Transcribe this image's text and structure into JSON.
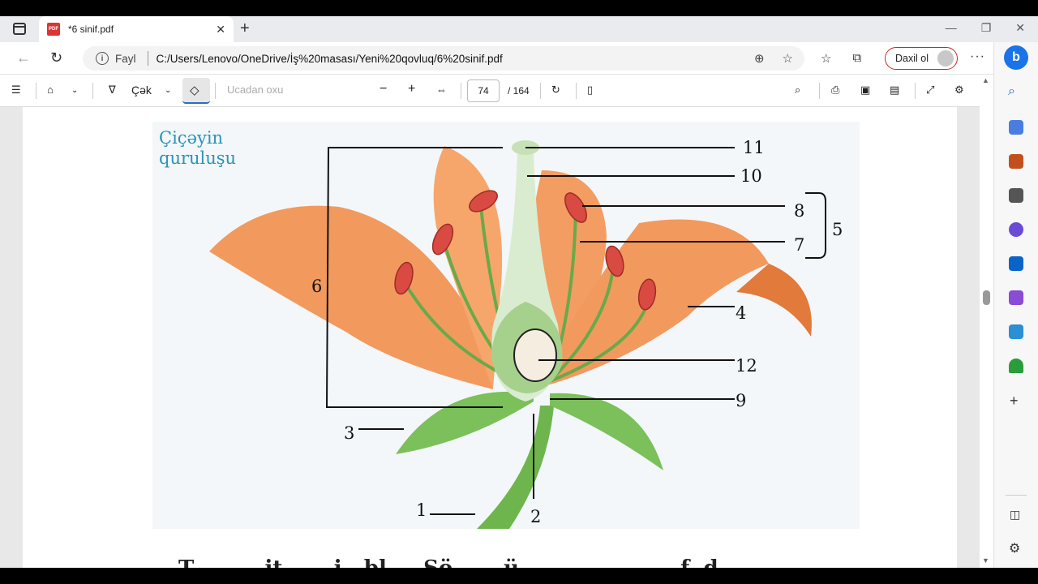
{
  "browser": {
    "tab_title": "*6 sinif.pdf",
    "pdf_badge": "PDF",
    "new_tab": "+",
    "tab_close": "✕",
    "address_label": "Fayl",
    "url": "C:/Users/Lenovo/OneDrive/İş%20masası/Yeni%20qovluq/6%20sinif.pdf",
    "signin_label": "Daxil ol"
  },
  "pdf_toolbar": {
    "draw_label": "Çək",
    "read_aloud_label": "Ucadan oxu",
    "current_page": "74",
    "total_pages": "/ 164"
  },
  "figure": {
    "title_line1": "Çiçəyin",
    "title_line2": "quruluşu",
    "labels": [
      "11",
      "10",
      "8",
      "7",
      "5",
      "6",
      "4",
      "12",
      "9",
      "3",
      "1",
      "2"
    ]
  },
  "below_text": "T...... ...it.. ....i...bl.... Sö.......ü........... ..... ....f..d.."
}
